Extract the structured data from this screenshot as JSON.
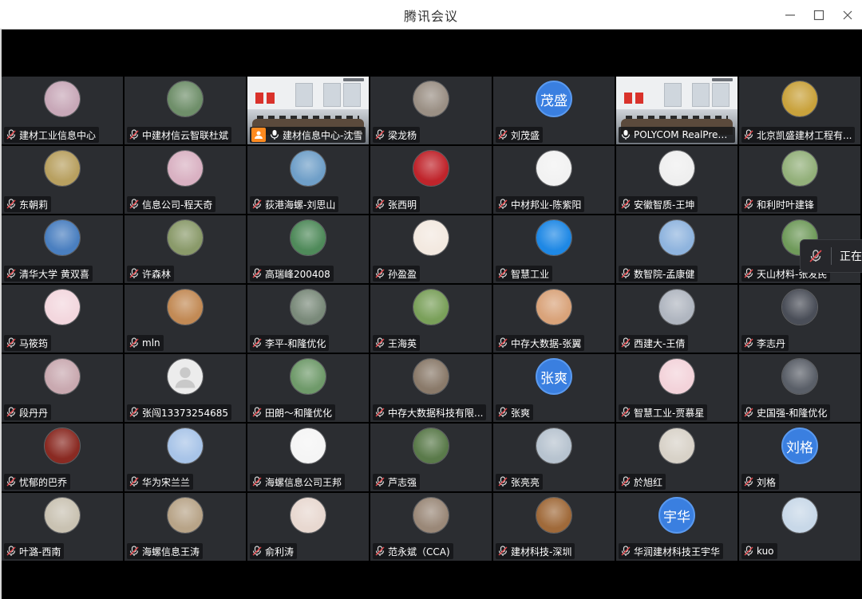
{
  "window": {
    "title": "腾讯会议",
    "minimize_label": "minimize",
    "maximize_label": "maximize",
    "close_label": "close"
  },
  "toast": {
    "text": "正在"
  },
  "colors": {
    "active_speaker": "#2fc25b",
    "avatar_text_bg": "#3a7fe0",
    "host_badge": "#ff8a1f",
    "tile_bg": "#2b2d31"
  },
  "participants": [
    {
      "name": "建材工业信息中心",
      "avatar": "photo-icon",
      "bg": "#c8a8b8"
    },
    {
      "name": "中建材信云智联杜斌",
      "avatar": "photo-icon",
      "bg": "#6f8f6a"
    },
    {
      "name": "建材信息中心-沈雪",
      "video": true,
      "active": true,
      "host": true
    },
    {
      "name": "梁龙杨",
      "avatar": "photo-icon",
      "bg": "#9a8f84"
    },
    {
      "name": "刘茂盛",
      "avatar_text": "茂盛"
    },
    {
      "name": "POLYCOM RealPres...",
      "video": true
    },
    {
      "name": "北京凯盛建材工程有...",
      "avatar": "photo-icon",
      "bg": "#c9a23c"
    },
    {
      "name": "东朝莉",
      "avatar": "photo-icon",
      "bg": "#b8a060"
    },
    {
      "name": "信息公司-程天奇",
      "avatar": "photo-icon",
      "bg": "#d9b1c2"
    },
    {
      "name": "荻港海螺-刘思山",
      "avatar": "photo-icon",
      "bg": "#6f9fc8"
    },
    {
      "name": "张西明",
      "avatar": "photo-icon",
      "bg": "#c0242b"
    },
    {
      "name": "中材邦业-陈紫阳",
      "avatar": "photo-icon",
      "bg": "#f2f2f2"
    },
    {
      "name": "安徽智质-王坤",
      "avatar": "photo-icon",
      "bg": "#efefef"
    },
    {
      "name": "和利时叶建锋",
      "avatar": "photo-icon",
      "bg": "#93b07a"
    },
    {
      "name": "清华大学 黄双喜",
      "avatar": "photo-icon",
      "bg": "#4a7fc0"
    },
    {
      "name": "许森林",
      "avatar": "photo-icon",
      "bg": "#8a9a6a"
    },
    {
      "name": "高瑞峰200408",
      "avatar": "photo-icon",
      "bg": "#4f8a5a"
    },
    {
      "name": "孙盈盈",
      "avatar": "photo-icon",
      "bg": "#f3e9e0"
    },
    {
      "name": "智慧工业",
      "avatar": "photo-icon",
      "bg": "#1e88e5"
    },
    {
      "name": "数智院-孟康健",
      "avatar": "photo-icon",
      "bg": "#8fb4de"
    },
    {
      "name": "天山材料-张发民",
      "avatar": "photo-icon",
      "bg": "#6f9a5a"
    },
    {
      "name": "马筱筠",
      "avatar": "photo-icon",
      "bg": "#f3d7de"
    },
    {
      "name": "mln",
      "avatar": "photo-icon",
      "bg": "#c28a55"
    },
    {
      "name": "李平-和隆优化",
      "avatar": "photo-icon",
      "bg": "#7a8a7a"
    },
    {
      "name": "王海英",
      "avatar": "photo-icon",
      "bg": "#7aa05a"
    },
    {
      "name": "中存大数据-张翼",
      "avatar": "photo-icon",
      "bg": "#d9a37a"
    },
    {
      "name": "西建大-王倩",
      "avatar": "photo-icon",
      "bg": "#b0b6c0"
    },
    {
      "name": "李志丹",
      "avatar": "photo-icon",
      "bg": "#4a4e58"
    },
    {
      "name": "段丹丹",
      "avatar": "photo-icon",
      "bg": "#c9a9b0"
    },
    {
      "name": "张闯13373254685",
      "avatar": "user-placeholder-icon",
      "bg": "#e9e9e9"
    },
    {
      "name": "田朗～和隆优化",
      "avatar": "photo-icon",
      "bg": "#6f9a6a"
    },
    {
      "name": "中存大数据科技有限...",
      "avatar": "photo-icon",
      "bg": "#8a7a6a"
    },
    {
      "name": "张爽",
      "avatar_text": "张爽"
    },
    {
      "name": "智慧工业-贾慕星",
      "avatar": "photo-icon",
      "bg": "#f3d3da"
    },
    {
      "name": "史国强-和隆优化",
      "avatar": "photo-icon",
      "bg": "#5a5f68"
    },
    {
      "name": "忧郁的巴乔",
      "avatar": "photo-icon",
      "bg": "#8a2a22"
    },
    {
      "name": "华为宋兰兰",
      "avatar": "photo-icon",
      "bg": "#a8c4e8"
    },
    {
      "name": "海螺信息公司王邦",
      "avatar": "photo-icon",
      "bg": "#f5f5f5"
    },
    {
      "name": "芦志强",
      "avatar": "photo-icon",
      "bg": "#5a7a4a"
    },
    {
      "name": "张亮亮",
      "avatar": "photo-icon",
      "bg": "#b7c3cf"
    },
    {
      "name": "於旭红",
      "avatar": "photo-icon",
      "bg": "#d8d2c8"
    },
    {
      "name": "刘格",
      "avatar_text": "刘格"
    },
    {
      "name": "叶潞-西南",
      "avatar": "photo-icon",
      "bg": "#c9c2b2"
    },
    {
      "name": "海螺信息王涛",
      "avatar": "photo-icon",
      "bg": "#b8a488"
    },
    {
      "name": "俞利涛",
      "avatar": "photo-icon",
      "bg": "#e8d8d0"
    },
    {
      "name": "范永斌（CCA)",
      "avatar": "photo-icon",
      "bg": "#9a8878"
    },
    {
      "name": "建材科技-深圳",
      "avatar": "photo-icon",
      "bg": "#a06a3a"
    },
    {
      "name": "华润建材科技王宇华",
      "avatar_text": "宇华"
    },
    {
      "name": "kuo",
      "avatar": "photo-icon",
      "bg": "#c8d8e8"
    }
  ]
}
